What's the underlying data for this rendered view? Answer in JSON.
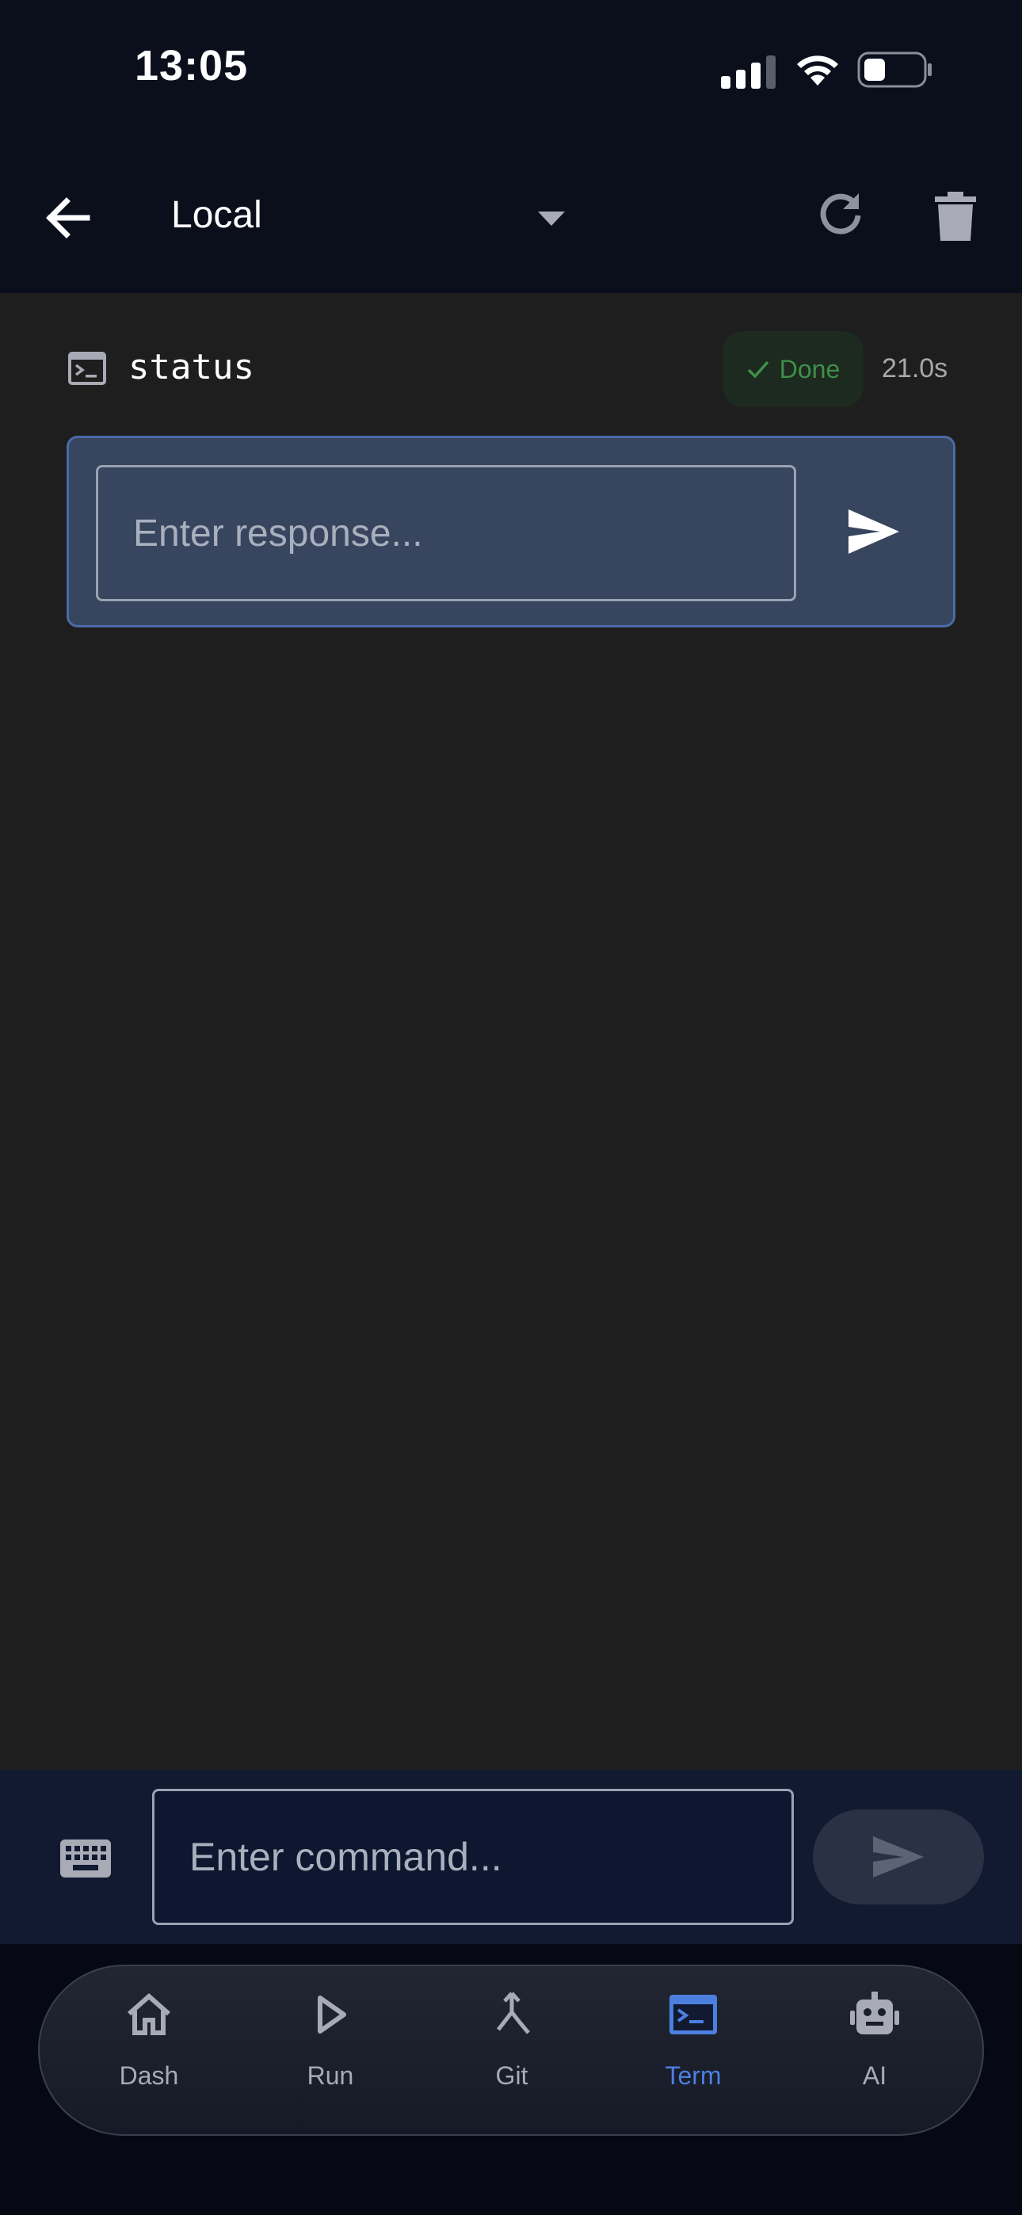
{
  "status_bar": {
    "time": "13:05"
  },
  "app_bar": {
    "title": "Local"
  },
  "command": {
    "name": "status",
    "status": "Done",
    "duration": "21.0s"
  },
  "response": {
    "placeholder": "Enter response..."
  },
  "command_bar": {
    "placeholder": "Enter command..."
  },
  "nav": {
    "items": [
      {
        "label": "Dash",
        "icon": "home-icon"
      },
      {
        "label": "Run",
        "icon": "play-icon"
      },
      {
        "label": "Git",
        "icon": "merge-icon"
      },
      {
        "label": "Term",
        "icon": "terminal-icon",
        "active": true
      },
      {
        "label": "AI",
        "icon": "robot-icon"
      }
    ]
  },
  "colors": {
    "background": "#1e1e1e",
    "header": "#0b0f1c",
    "accent": "#4c7fe0",
    "success": "#3f8f4a",
    "response_card": "#38455e"
  }
}
